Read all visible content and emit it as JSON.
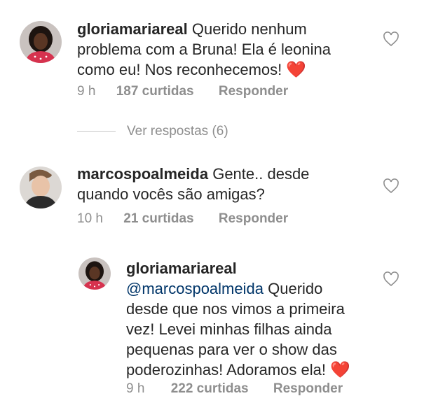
{
  "colors": {
    "text": "#262626",
    "meta": "#8e8e8e",
    "mention": "#003569",
    "heart": "#e0102a"
  },
  "comments": [
    {
      "username": "gloriamariareal",
      "text": "Querido nenhum problema com a Bruna! Ela é leonina como eu! Nos reconhecemos!",
      "emoji": "❤️",
      "time": "9 h",
      "likes": "187 curtidas",
      "reply": "Responder",
      "avatar_icon": "avatar-woman-icon"
    },
    {
      "username": "marcospoalmeida",
      "text": "Gente.. desde quando vocês são amigas?",
      "time": "10 h",
      "likes": "21 curtidas",
      "reply": "Responder",
      "avatar_icon": "avatar-man-icon"
    },
    {
      "username": "gloriamariareal",
      "mention": "@marcospoalmeida",
      "text": "Querido desde que nos vimos a primeira vez! Levei minhas filhas ainda pequenas para ver o show das poderozinhas! Adoramos ela!",
      "emoji": "❤️",
      "time": "9 h",
      "likes": "222 curtidas",
      "reply": "Responder",
      "avatar_icon": "avatar-woman-icon"
    }
  ],
  "view_replies": "Ver respostas (6)",
  "like_icon": "heart-outline-icon"
}
